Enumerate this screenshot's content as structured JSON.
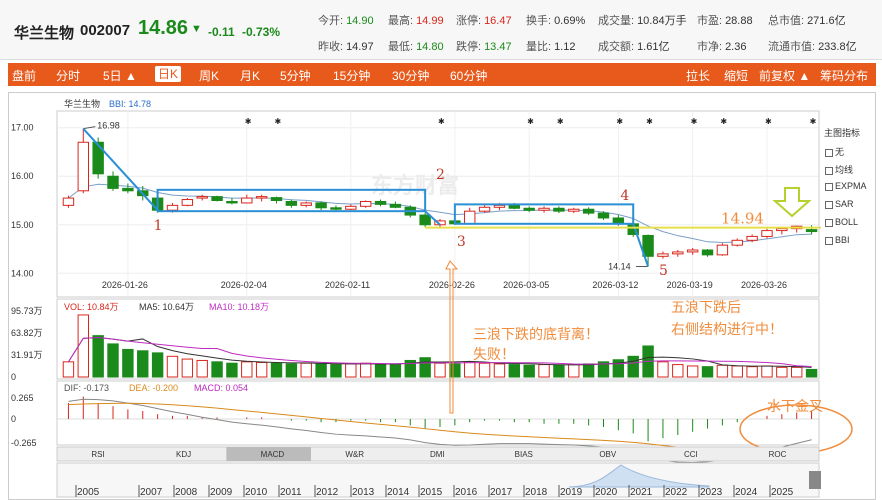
{
  "stock": {
    "name": "华兰生物",
    "code": "002007",
    "price": "14.86",
    "arrow": "▼",
    "change": "-0.11",
    "change_pct": "-0.73%"
  },
  "quotes_row1": [
    {
      "label": "今开:",
      "value": "14.90",
      "color": "green"
    },
    {
      "label": "最高:",
      "value": "14.99",
      "color": "red"
    },
    {
      "label": "涨停:",
      "value": "16.47",
      "color": "red"
    },
    {
      "label": "换手:",
      "value": "0.69%",
      "color": "dark"
    },
    {
      "label": "成交量:",
      "value": "10.84万手",
      "color": "dark"
    },
    {
      "label": "市盈:",
      "value": "28.88",
      "color": "dark"
    },
    {
      "label": "总市值:",
      "value": "271.6亿",
      "color": "dark"
    }
  ],
  "quotes_row2": [
    {
      "label": "昨收:",
      "value": "14.97",
      "color": "dark"
    },
    {
      "label": "最低:",
      "value": "14.80",
      "color": "green"
    },
    {
      "label": "跌停:",
      "value": "13.47",
      "color": "green"
    },
    {
      "label": "量比:",
      "value": "1.12",
      "color": "dark"
    },
    {
      "label": "成交额:",
      "value": "1.61亿",
      "color": "dark"
    },
    {
      "label": "市净:",
      "value": "2.36",
      "color": "dark"
    },
    {
      "label": "流通市值:",
      "value": "233.8亿",
      "color": "dark"
    }
  ],
  "toolbar": {
    "left": [
      "盘前",
      "分时",
      "5日 ▲",
      "日K",
      "周K",
      "月K",
      "5分钟",
      "15分钟",
      "30分钟",
      "60分钟"
    ],
    "active": "日K",
    "right": [
      "拉长",
      "缩短",
      "前复权 ▲",
      "筹码分布"
    ]
  },
  "main": {
    "title": "华兰生物",
    "indicator": "BBI: 14.78",
    "y_ticks": [
      "17.00",
      "16.00",
      "15.00",
      "14.00"
    ],
    "x_ticks": [
      "2026-01-26",
      "2026-02-04",
      "2026-02-11",
      "2026-02-26",
      "2026-03-05",
      "2026-03-12",
      "2026-03-19",
      "2026-03-26"
    ],
    "high_label": "16.98",
    "low_label": "14.14",
    "watermark": "东方财富"
  },
  "legend": {
    "title": "主图指标",
    "items": [
      "无",
      "均线",
      "EXPMA",
      "SAR",
      "BOLL",
      "BBI"
    ]
  },
  "volume": {
    "vol": "VOL: 10.84万",
    "ma5": "MA5: 10.64万",
    "ma10": "MA10: 10.18万",
    "y_ticks": [
      "95.73万",
      "63.82万",
      "31.91万",
      "0"
    ]
  },
  "macd": {
    "dif": "DIF: -0.173",
    "dea": "DEA: -0.200",
    "macd": "MACD: 0.054",
    "y_ticks": [
      "0.265",
      "0",
      "-0.265"
    ]
  },
  "indicator_tabs": [
    "RSI",
    "KDJ",
    "MACD",
    "W&R",
    "DMI",
    "BIAS",
    "OBV",
    "CCI",
    "ROC"
  ],
  "active_tab": "MACD",
  "timeline_years": [
    "2005",
    "2007",
    "2008",
    "2009",
    "2010",
    "2011",
    "2012",
    "2013",
    "2014",
    "2015",
    "2016",
    "2017",
    "2018",
    "2019",
    "2020",
    "2021",
    "2022",
    "2023",
    "2024",
    "2025"
  ],
  "annotations": {
    "wave_labels": [
      "1",
      "2",
      "3",
      "4",
      "5"
    ],
    "level": "14.94",
    "note_left": "三浪下跌的底背离！失败！",
    "note_right": "五浪下跌后右侧结构进行中！",
    "note_macd": "水下金叉"
  },
  "colors": {
    "up": "#d9261c",
    "down": "#1a8a1a",
    "accent": "#e8591c",
    "box": "#2b8fd6",
    "annot": "#f08c3c"
  },
  "chart_data": {
    "type": "candlestick",
    "candles": [
      {
        "o": 15.4,
        "h": 15.6,
        "l": 15.35,
        "c": 15.55
      },
      {
        "o": 15.7,
        "h": 16.98,
        "l": 15.65,
        "c": 16.7
      },
      {
        "o": 16.7,
        "h": 16.8,
        "l": 15.95,
        "c": 16.05
      },
      {
        "o": 16.0,
        "h": 16.1,
        "l": 15.7,
        "c": 15.75
      },
      {
        "o": 15.75,
        "h": 15.85,
        "l": 15.65,
        "c": 15.7
      },
      {
        "o": 15.7,
        "h": 15.8,
        "l": 15.5,
        "c": 15.6
      },
      {
        "o": 15.55,
        "h": 15.6,
        "l": 15.25,
        "c": 15.3
      },
      {
        "o": 15.3,
        "h": 15.45,
        "l": 15.25,
        "c": 15.4
      },
      {
        "o": 15.4,
        "h": 15.55,
        "l": 15.38,
        "c": 15.52
      },
      {
        "o": 15.55,
        "h": 15.62,
        "l": 15.5,
        "c": 15.58
      },
      {
        "o": 15.58,
        "h": 15.6,
        "l": 15.48,
        "c": 15.5
      },
      {
        "o": 15.48,
        "h": 15.55,
        "l": 15.42,
        "c": 15.45
      },
      {
        "o": 15.45,
        "h": 15.62,
        "l": 15.44,
        "c": 15.55
      },
      {
        "o": 15.55,
        "h": 15.62,
        "l": 15.48,
        "c": 15.58
      },
      {
        "o": 15.56,
        "h": 15.58,
        "l": 15.44,
        "c": 15.5
      },
      {
        "o": 15.48,
        "h": 15.52,
        "l": 15.35,
        "c": 15.4
      },
      {
        "o": 15.4,
        "h": 15.48,
        "l": 15.36,
        "c": 15.45
      },
      {
        "o": 15.45,
        "h": 15.48,
        "l": 15.3,
        "c": 15.35
      },
      {
        "o": 15.35,
        "h": 15.4,
        "l": 15.28,
        "c": 15.32
      },
      {
        "o": 15.32,
        "h": 15.42,
        "l": 15.3,
        "c": 15.38
      },
      {
        "o": 15.38,
        "h": 15.5,
        "l": 15.35,
        "c": 15.48
      },
      {
        "o": 15.48,
        "h": 15.52,
        "l": 15.38,
        "c": 15.42
      },
      {
        "o": 15.42,
        "h": 15.48,
        "l": 15.34,
        "c": 15.36
      },
      {
        "o": 15.36,
        "h": 15.4,
        "l": 15.15,
        "c": 15.2
      },
      {
        "o": 15.2,
        "h": 15.25,
        "l": 14.95,
        "c": 15.0
      },
      {
        "o": 15.0,
        "h": 15.12,
        "l": 14.95,
        "c": 15.08
      },
      {
        "o": 15.08,
        "h": 15.15,
        "l": 15.0,
        "c": 15.02
      },
      {
        "o": 15.02,
        "h": 15.35,
        "l": 15.0,
        "c": 15.28
      },
      {
        "o": 15.28,
        "h": 15.4,
        "l": 15.25,
        "c": 15.36
      },
      {
        "o": 15.36,
        "h": 15.45,
        "l": 15.3,
        "c": 15.4
      },
      {
        "o": 15.4,
        "h": 15.45,
        "l": 15.32,
        "c": 15.34
      },
      {
        "o": 15.34,
        "h": 15.38,
        "l": 15.26,
        "c": 15.3
      },
      {
        "o": 15.3,
        "h": 15.38,
        "l": 15.25,
        "c": 15.34
      },
      {
        "o": 15.34,
        "h": 15.38,
        "l": 15.24,
        "c": 15.28
      },
      {
        "o": 15.28,
        "h": 15.35,
        "l": 15.24,
        "c": 15.32
      },
      {
        "o": 15.32,
        "h": 15.36,
        "l": 15.2,
        "c": 15.24
      },
      {
        "o": 15.24,
        "h": 15.28,
        "l": 15.1,
        "c": 15.14
      },
      {
        "o": 15.14,
        "h": 15.2,
        "l": 14.98,
        "c": 15.02
      },
      {
        "o": 15.02,
        "h": 15.05,
        "l": 14.75,
        "c": 14.8
      },
      {
        "o": 14.78,
        "h": 14.8,
        "l": 14.14,
        "c": 14.35
      },
      {
        "o": 14.35,
        "h": 14.45,
        "l": 14.3,
        "c": 14.4
      },
      {
        "o": 14.4,
        "h": 14.48,
        "l": 14.34,
        "c": 14.44
      },
      {
        "o": 14.44,
        "h": 14.52,
        "l": 14.38,
        "c": 14.48
      },
      {
        "o": 14.48,
        "h": 14.5,
        "l": 14.34,
        "c": 14.38
      },
      {
        "o": 14.38,
        "h": 14.62,
        "l": 14.36,
        "c": 14.58
      },
      {
        "o": 14.58,
        "h": 14.72,
        "l": 14.55,
        "c": 14.68
      },
      {
        "o": 14.68,
        "h": 14.8,
        "l": 14.64,
        "c": 14.76
      },
      {
        "o": 14.76,
        "h": 14.92,
        "l": 14.72,
        "c": 14.88
      },
      {
        "o": 14.88,
        "h": 14.96,
        "l": 14.8,
        "c": 14.92
      },
      {
        "o": 14.92,
        "h": 14.98,
        "l": 14.84,
        "c": 14.97
      },
      {
        "o": 14.9,
        "h": 14.99,
        "l": 14.8,
        "c": 14.86
      }
    ],
    "volume": [
      22,
      90,
      60,
      48,
      40,
      38,
      35,
      30,
      26,
      24,
      22,
      20,
      22,
      21,
      20,
      19,
      20,
      19,
      18,
      19,
      20,
      18,
      19,
      24,
      28,
      20,
      19,
      22,
      20,
      19,
      18,
      17,
      18,
      17,
      18,
      19,
      22,
      25,
      30,
      45,
      22,
      18,
      16,
      15,
      17,
      16,
      15,
      16,
      14,
      14,
      11
    ],
    "macd_hist": [
      0.1,
      0.14,
      0.1,
      0.08,
      0.06,
      0.05,
      0.03,
      0.02,
      0.02,
      0.01,
      0.01,
      0.0,
      0.01,
      0.01,
      0.0,
      -0.01,
      -0.01,
      -0.02,
      -0.02,
      -0.01,
      -0.01,
      -0.02,
      -0.02,
      -0.04,
      -0.06,
      -0.05,
      -0.04,
      -0.02,
      -0.01,
      -0.01,
      -0.02,
      -0.02,
      -0.03,
      -0.03,
      -0.03,
      -0.04,
      -0.05,
      -0.07,
      -0.09,
      -0.14,
      -0.12,
      -0.1,
      -0.08,
      -0.06,
      -0.04,
      -0.02,
      0.0,
      0.02,
      0.03,
      0.04,
      0.05
    ],
    "vol_ylim": [
      0,
      95.73
    ],
    "price_ylim": [
      13.8,
      17.2
    ]
  }
}
